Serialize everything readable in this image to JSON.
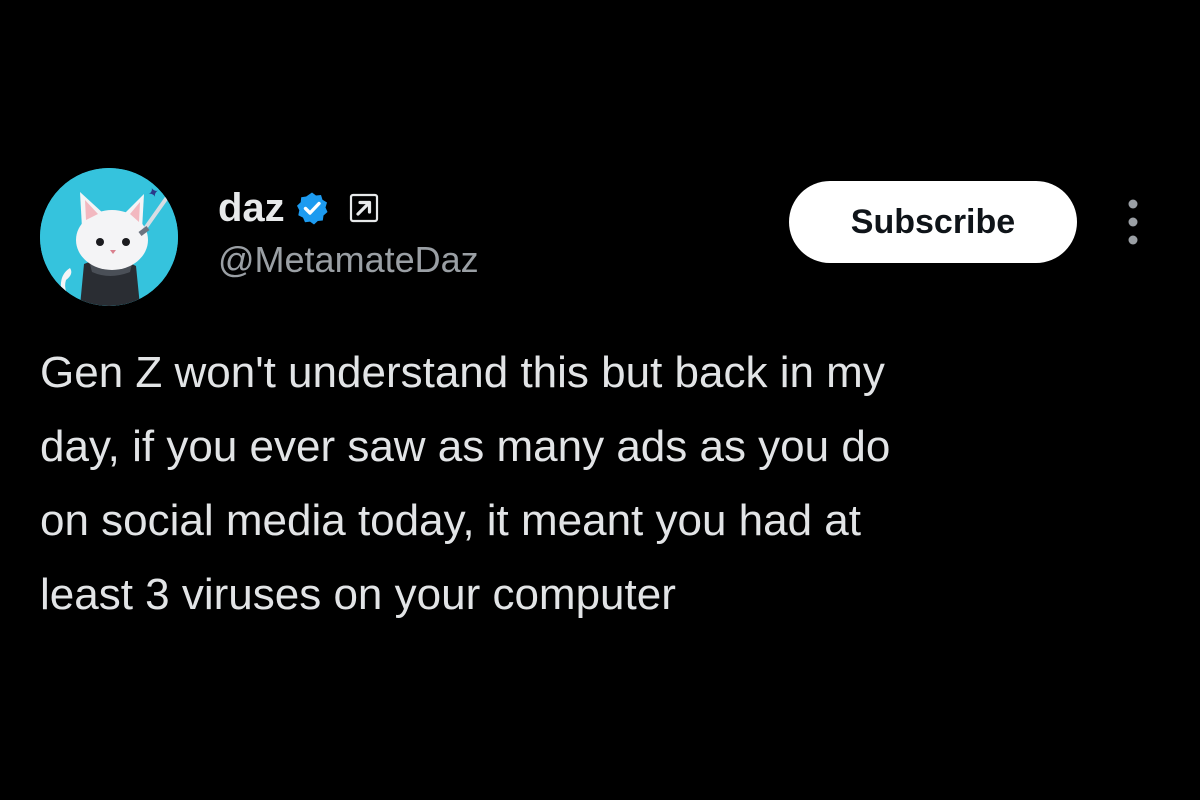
{
  "post": {
    "author": {
      "display_name": "daz",
      "handle": "@MetamateDaz",
      "avatar_icon": "cat-avatar-icon",
      "verified_icon": "verified-badge-icon",
      "affiliate_icon": "external-arrow-icon"
    },
    "subscribe_label": "Subscribe",
    "more_icon": "more-options-icon",
    "text": "Gen Z won't understand this but back in my\nday, if you ever saw as many ads as you do\non social media today, it meant you had at\nleast 3 viruses on your computer"
  },
  "colors": {
    "background": "#000000",
    "text": "#e7e9ea",
    "handle": "#9a9fa4",
    "verified": "#1d9bf0",
    "avatar_bg": "#35c3dd",
    "button_bg": "#ffffff",
    "button_text": "#0f1419"
  }
}
